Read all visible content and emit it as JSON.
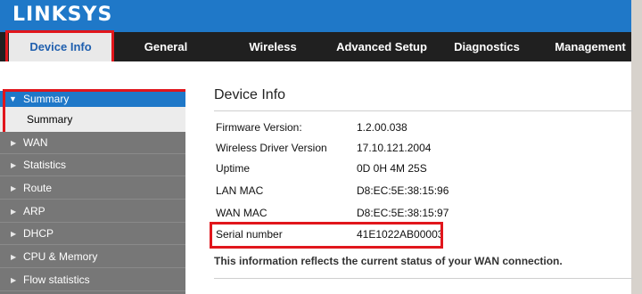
{
  "header": {
    "logo": "LINKSYS"
  },
  "nav": {
    "tabs": [
      {
        "label": "Device Info",
        "active": true
      },
      {
        "label": "General"
      },
      {
        "label": "Wireless"
      },
      {
        "label": "Advanced Setup"
      },
      {
        "label": "Diagnostics"
      },
      {
        "label": "Management"
      }
    ]
  },
  "sidebar": {
    "section": {
      "label": "Summary",
      "expanded": true,
      "icon": "caret-down-icon"
    },
    "selected": {
      "label": "Summary"
    },
    "items": [
      {
        "label": "WAN",
        "icon": "caret-right-icon"
      },
      {
        "label": "Statistics",
        "icon": "caret-right-icon"
      },
      {
        "label": "Route",
        "icon": "caret-right-icon"
      },
      {
        "label": "ARP",
        "icon": "caret-right-icon"
      },
      {
        "label": "DHCP",
        "icon": "caret-right-icon"
      },
      {
        "label": "CPU & Memory",
        "icon": "caret-right-icon"
      },
      {
        "label": "Flow statistics",
        "icon": "caret-right-icon"
      }
    ]
  },
  "main": {
    "title": "Device Info",
    "rows": [
      {
        "label": "Firmware Version:",
        "value": "1.2.00.038"
      },
      {
        "label": "Wireless Driver Version",
        "value": "17.10.121.2004"
      },
      {
        "label": "Uptime",
        "value": "0D 0H 4M 25S"
      },
      {
        "label": "LAN MAC",
        "value": "D8:EC:5E:38:15:96"
      },
      {
        "label": "WAN MAC",
        "value": "D8:EC:5E:38:15:97"
      },
      {
        "label": "Serial number",
        "value": "41E1022AB00003"
      }
    ],
    "note": "This information reflects the current status of your WAN connection."
  },
  "colors": {
    "brand_blue": "#1f78c8",
    "nav_dark": "#202020",
    "sidebar_gray": "#777777",
    "highlight_red": "#e1161c"
  }
}
